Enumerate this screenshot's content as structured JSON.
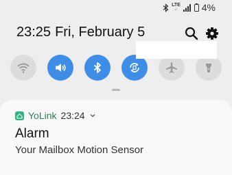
{
  "status_bar": {
    "network": "LTE",
    "battery": "4%",
    "icons": [
      "bluetooth-icon",
      "lte-icon",
      "signal-icon"
    ]
  },
  "header": {
    "time": "23:25",
    "date": "Fri, February 5",
    "icons": [
      "search-icon",
      "gear-icon"
    ]
  },
  "quick_settings": {
    "accent_color": "#3e8ee8",
    "toggles": [
      {
        "icon": "wifi-icon",
        "state": "off"
      },
      {
        "icon": "sound-icon",
        "state": "on"
      },
      {
        "icon": "bluetooth-icon",
        "state": "on"
      },
      {
        "icon": "auto-rotate-icon",
        "state": "on"
      },
      {
        "icon": "airplane-icon",
        "state": "off"
      },
      {
        "icon": "flashlight-icon",
        "state": "off"
      }
    ]
  },
  "notification": {
    "app_name": "YoLink",
    "time": "23:24",
    "title": "Alarm",
    "body": "Your Mailbox Motion Sensor",
    "app_color": "#2fb57f"
  }
}
